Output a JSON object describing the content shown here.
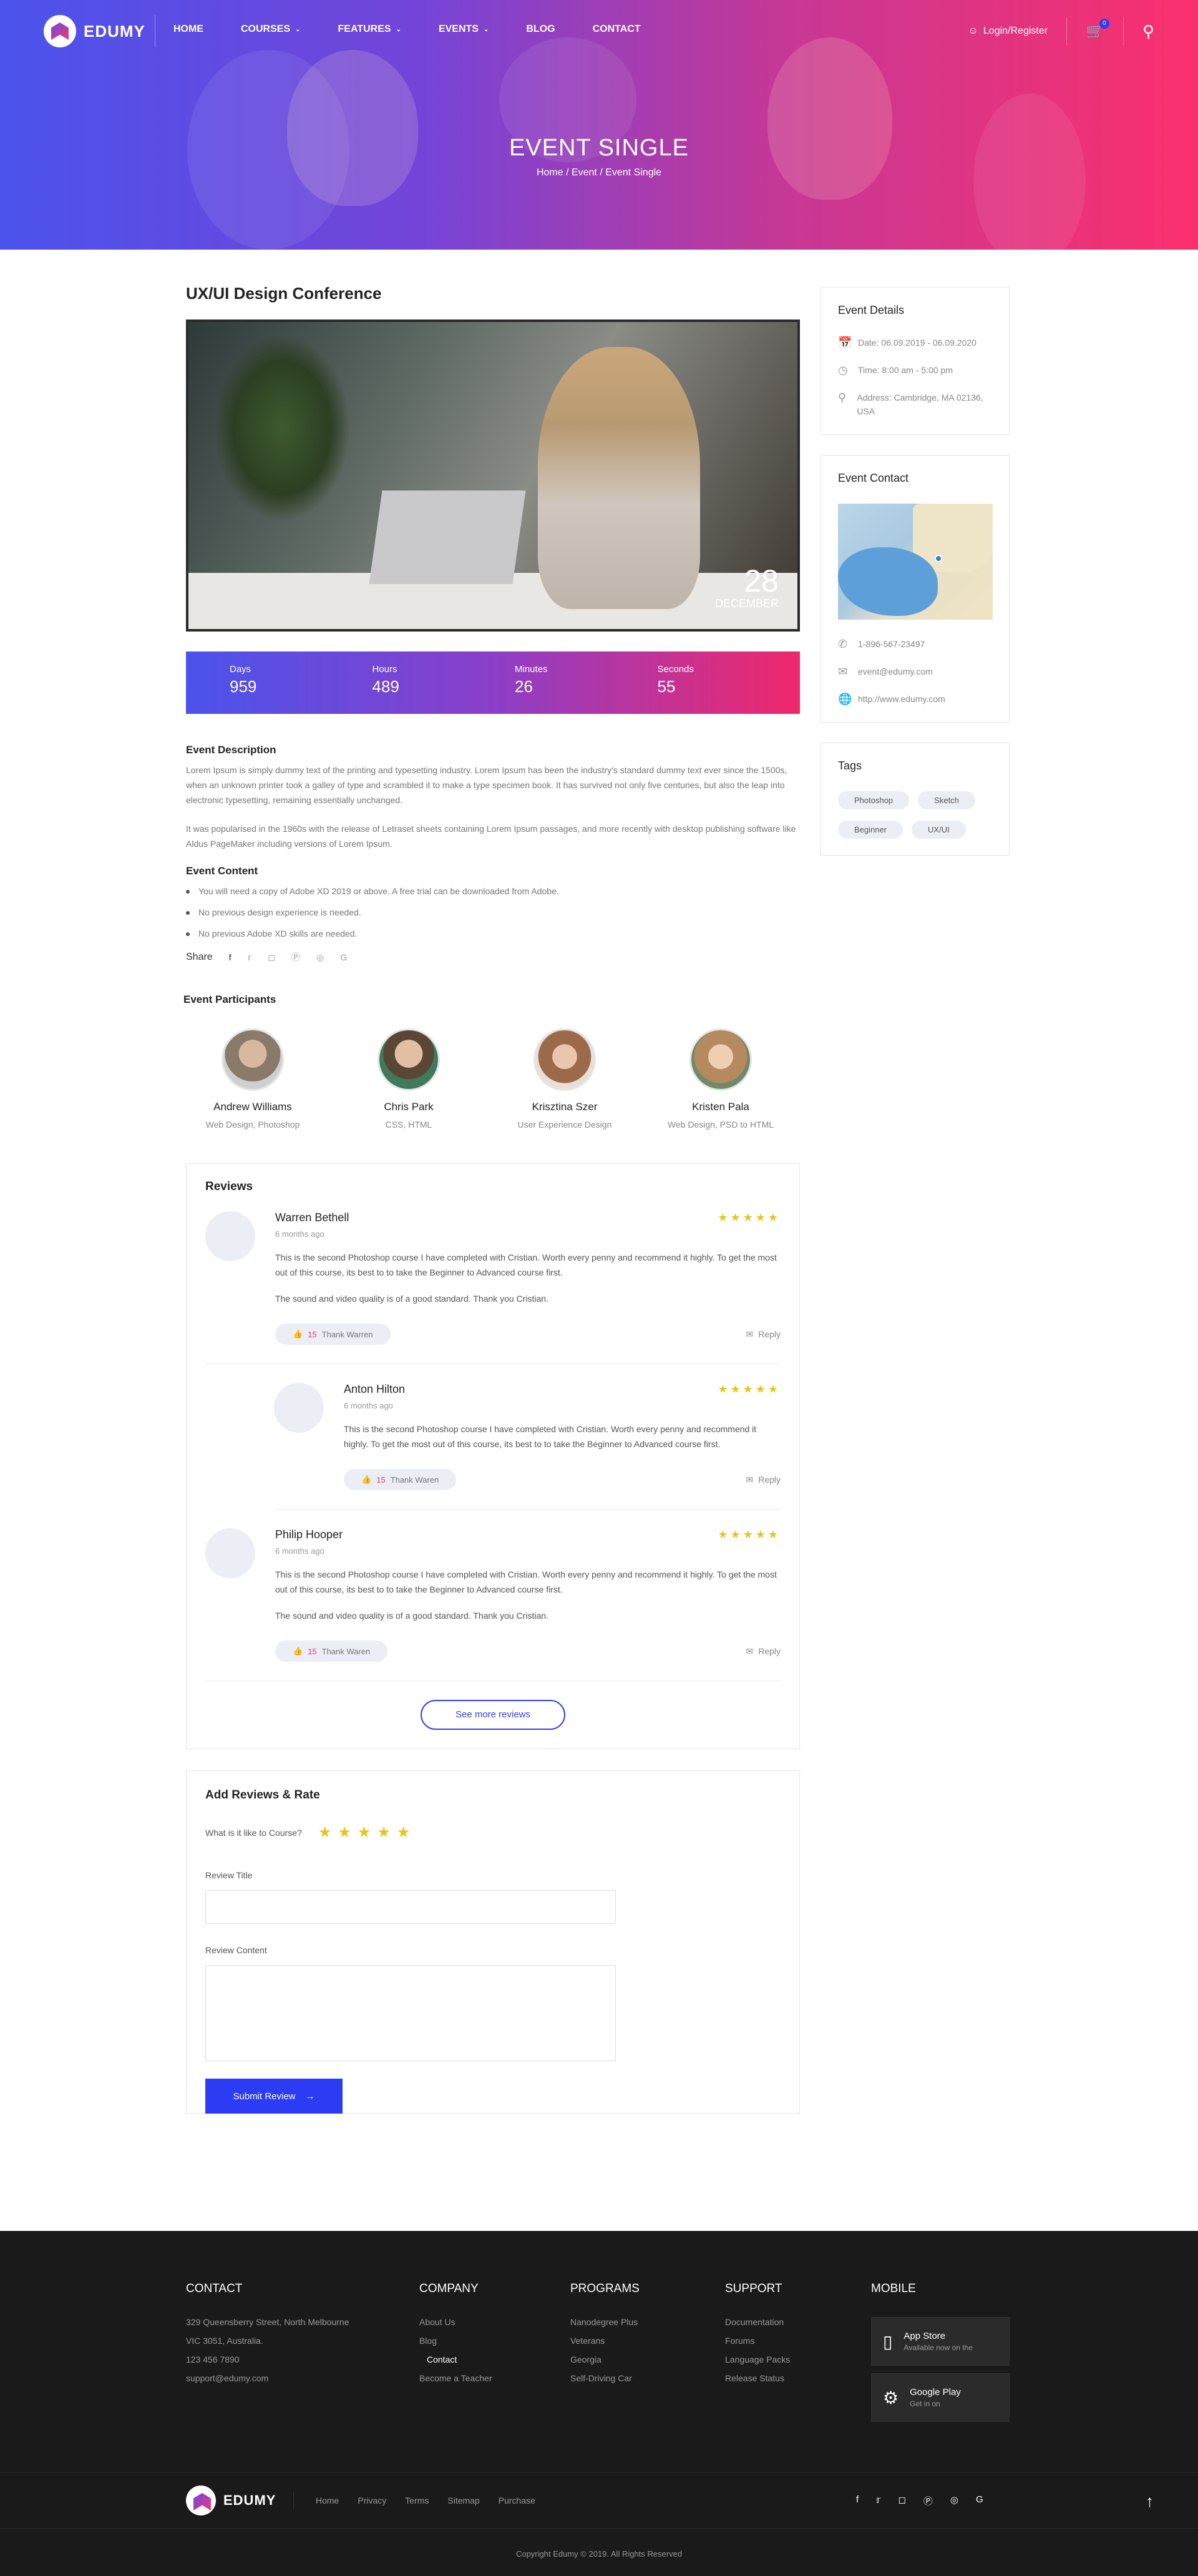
{
  "nav": {
    "logo": "EDUMY",
    "items": [
      {
        "label": "HOME",
        "dropdown": false
      },
      {
        "label": "COURSES",
        "dropdown": true
      },
      {
        "label": "FEATURES",
        "dropdown": true
      },
      {
        "label": "EVENTS",
        "dropdown": true
      },
      {
        "label": "BLOG",
        "dropdown": false
      },
      {
        "label": "CONTACT",
        "dropdown": false
      }
    ],
    "login": "Login/Register",
    "cart_count": "0"
  },
  "hero": {
    "title": "EVENT SINGLE",
    "breadcrumb": "Home / Event / Event Single"
  },
  "event": {
    "title": "UX/UI Design Conference",
    "date_day": "28",
    "date_month": "DECEMBER",
    "countdown": [
      {
        "label": "Days",
        "value": "959"
      },
      {
        "label": "Hours",
        "value": "489"
      },
      {
        "label": "Minutes",
        "value": "26"
      },
      {
        "label": "Seconds",
        "value": "55"
      }
    ],
    "description_heading": "Event Description",
    "description_p1": "Lorem Ipsum is simply dummy text of the printing and typesetting industry. Lorem Ipsum has been the industry's standard dummy text ever since the 1500s, when an unknown printer took a galley of type and scrambled it to make a type specimen book. It has survived not only five centuries, but also the leap into electronic typesetting, remaining essentially unchanged.",
    "description_p2": "It was popularised in the 1960s with the release of Letraset sheets containing Lorem Ipsum passages, and more recently with desktop publishing software like Aldus PageMaker including versions of Lorem Ipsum.",
    "content_heading": "Event Content",
    "content_items": [
      "You will need a copy of Adobe XD 2019 or above. A free trial can be downloaded from Adobe.",
      "No previous design experience is needed.",
      "No previous Adobe XD skills are needed."
    ],
    "share_label": "Share",
    "participants_heading": "Event Participants",
    "participants": [
      {
        "name": "Andrew Williams",
        "role": "Web Design, Photoshop"
      },
      {
        "name": "Chris Park",
        "role": "CSS, HTML"
      },
      {
        "name": "Krisztina Szer",
        "role": "User Experience Design"
      },
      {
        "name": "Kristen Pala",
        "role": "Web Design, PSD to HTML"
      }
    ]
  },
  "reviews": {
    "heading": "Reviews",
    "items": [
      {
        "name": "Warren Bethell",
        "time": "6 months ago",
        "text1": "This is the second Photoshop course I have completed with Cristian. Worth every penny and recommend it highly. To get the most out of this course, its best to to take the Beginner to Advanced course first.",
        "text2": "The sound and video quality is of a good standard. Thank you Cristian.",
        "likes": "15",
        "thank": "Thank Warren",
        "reply": "Reply"
      },
      {
        "name": "Anton Hilton",
        "time": "6 months ago",
        "text1": "This is the second Photoshop course I have completed with Cristian. Worth every penny and recommend it highly. To get the most out of this course, its best to to take the Beginner to Advanced course first.",
        "text2": "",
        "likes": "15",
        "thank": "Thank Waren",
        "reply": "Reply"
      },
      {
        "name": "Philip Hooper",
        "time": "6 months ago",
        "text1": "This is the second Photoshop course I have completed with Cristian. Worth every penny and recommend it highly. To get the most out of this course, its best to to take the Beginner to Advanced course first.",
        "text2": "The sound and video quality is of a good standard. Thank you Cristian.",
        "likes": "15",
        "thank": "Thank Waren",
        "reply": "Reply"
      }
    ],
    "see_more": "See more reviews",
    "rating_stars": 5
  },
  "add_review": {
    "heading": "Add Reviews & Rate",
    "question": "What is it like to Course?",
    "title_label": "Review Title",
    "content_label": "Review Content",
    "submit": "Submit Review"
  },
  "sidebar": {
    "details_heading": "Event Details",
    "date": "Date: 06.09.2019 - 06.09.2020",
    "time": "Time: 8:00 am - 5:00 pm",
    "address": "Address: Cambridge, MA 02136, USA",
    "contact_heading": "Event Contact",
    "phone": "1-896-567-23497",
    "email": "event@edumy.com",
    "website": "http://www.edumy.com",
    "tags_heading": "Tags",
    "tags": [
      "Photoshop",
      "Sketch",
      "Beginner",
      "UX/UI"
    ]
  },
  "footer": {
    "contact_heading": "CONTACT",
    "contact_lines": [
      "329 Queensberry Street, North Melbourne",
      "VIC 3051, Australia.",
      "123 456 7890",
      "support@edumy.com"
    ],
    "company_heading": "COMPANY",
    "company_links": [
      "About Us",
      "Blog",
      "Contact",
      "Become a Teacher"
    ],
    "programs_heading": "PROGRAMS",
    "programs_links": [
      "Nanodegree Plus",
      "Veterans",
      "Georgia",
      "Self-Driving Car"
    ],
    "support_heading": "SUPPORT",
    "support_links": [
      "Documentation",
      "Forums",
      "Language Packs",
      "Release Status"
    ],
    "mobile_heading": "MOBILE",
    "stores": [
      {
        "name": "App Store",
        "sub": "Available now on the"
      },
      {
        "name": "Google Play",
        "sub": "Get in on"
      }
    ],
    "logo": "EDUMY",
    "bottom_links": [
      "Home",
      "Privacy",
      "Terms",
      "Sitemap",
      "Purchase"
    ],
    "copyright": "Copyright Edumy © 2019. All Rights Reserved"
  },
  "colors": {
    "accent_blue": "#2c3cf5",
    "accent_pink": "#f23679",
    "star_yellow": "#e6c61a"
  }
}
